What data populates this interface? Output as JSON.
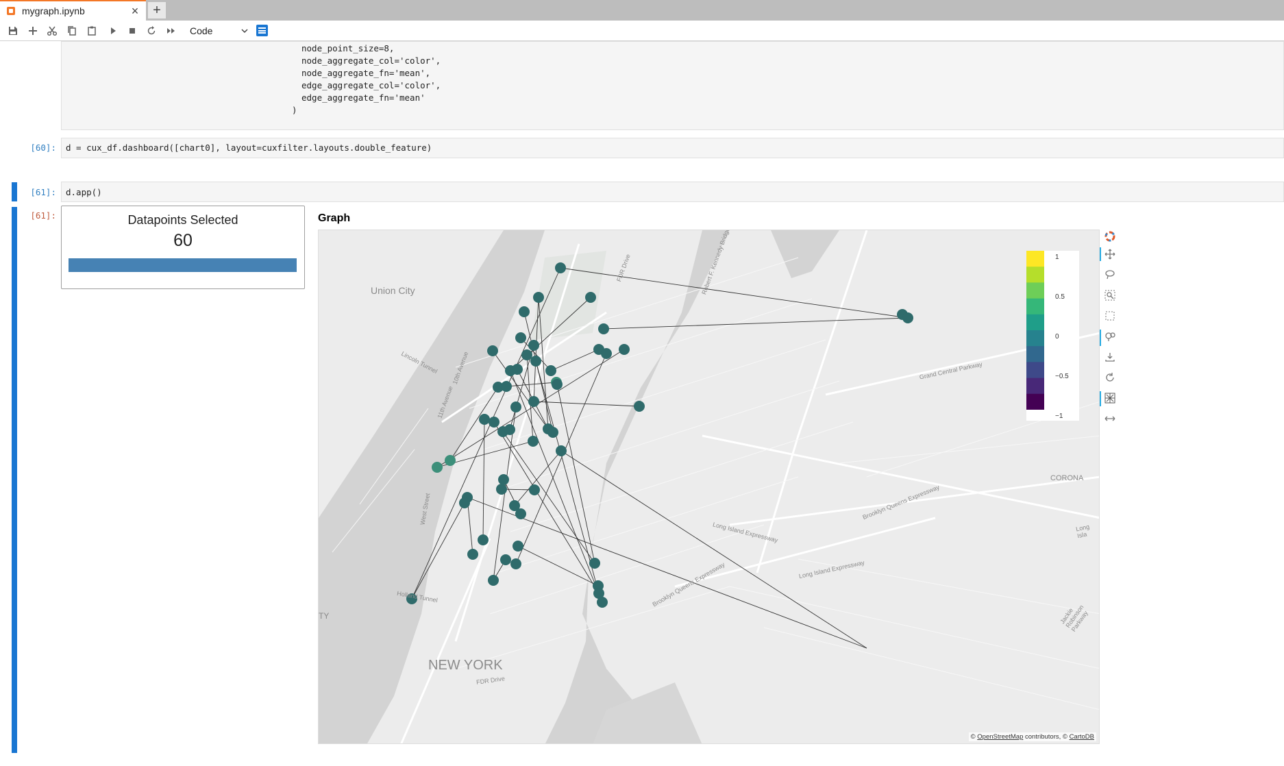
{
  "tab": {
    "title": "mygraph.ipynb",
    "close": "×",
    "new": "+"
  },
  "toolbar": {
    "cell_type": "Code"
  },
  "cell_59": {
    "lines": [
      "node_point_size=8,",
      "node_aggregate_col='color',",
      "node_aggregate_fn='mean',",
      "edge_aggregate_col='color',",
      "edge_aggregate_fn='mean'",
      ")"
    ]
  },
  "cell_60": {
    "prompt": "[60]:",
    "code": "d = cux_df.dashboard([chart0], layout=cuxfilter.layouts.double_feature)"
  },
  "cell_61": {
    "prompt": "[61]:",
    "code": "d.app()",
    "out_prompt": "[61]:"
  },
  "datapoints": {
    "title": "Datapoints Selected",
    "value": "60",
    "fraction": 1.0
  },
  "graph": {
    "title": "Graph",
    "attribution": {
      "prefix": "© ",
      "osm": "OpenStreetMap",
      "mid": " contributors, © ",
      "carto": "CartoDB"
    },
    "place_labels": [
      "Union City",
      "NEW YORK",
      "CORONA",
      "TY"
    ],
    "road_labels": [
      "Lincoln Tunnel",
      "Grand Central Parkway",
      "Long Island Expressway",
      "Brooklyn Queens Expressway",
      "Long Island Expressway",
      "FDR Drive",
      "FDR Drive",
      "Holland Tunnel",
      "West Street",
      "11th Avenue",
      "10th Avenue",
      "Brooklyn Queens Expressway",
      "Jackie Robinson Parkway",
      "Long Isla",
      "Robert F. Kennedy Bridge"
    ],
    "colorbar": {
      "ticks": [
        "1",
        "0.5",
        "0",
        "−0.5",
        "−1"
      ],
      "colormap": "viridis"
    },
    "node_color": "#2f6b6b",
    "node_highlight_color": "#3c8f7a",
    "edge_color": "#333333"
  },
  "icons": {
    "toolbar": [
      "save-icon",
      "add-icon",
      "cut-icon",
      "copy-icon",
      "paste-icon",
      "run-icon",
      "stop-icon",
      "restart-icon",
      "fast-forward-icon"
    ],
    "bokeh": [
      "bokeh-logo-icon",
      "pan-icon",
      "lasso-icon",
      "zoom-box-icon",
      "box-select-icon",
      "wheel-zoom-icon",
      "save-icon",
      "reset-icon",
      "hover-icon",
      "x-pan-icon"
    ]
  }
}
